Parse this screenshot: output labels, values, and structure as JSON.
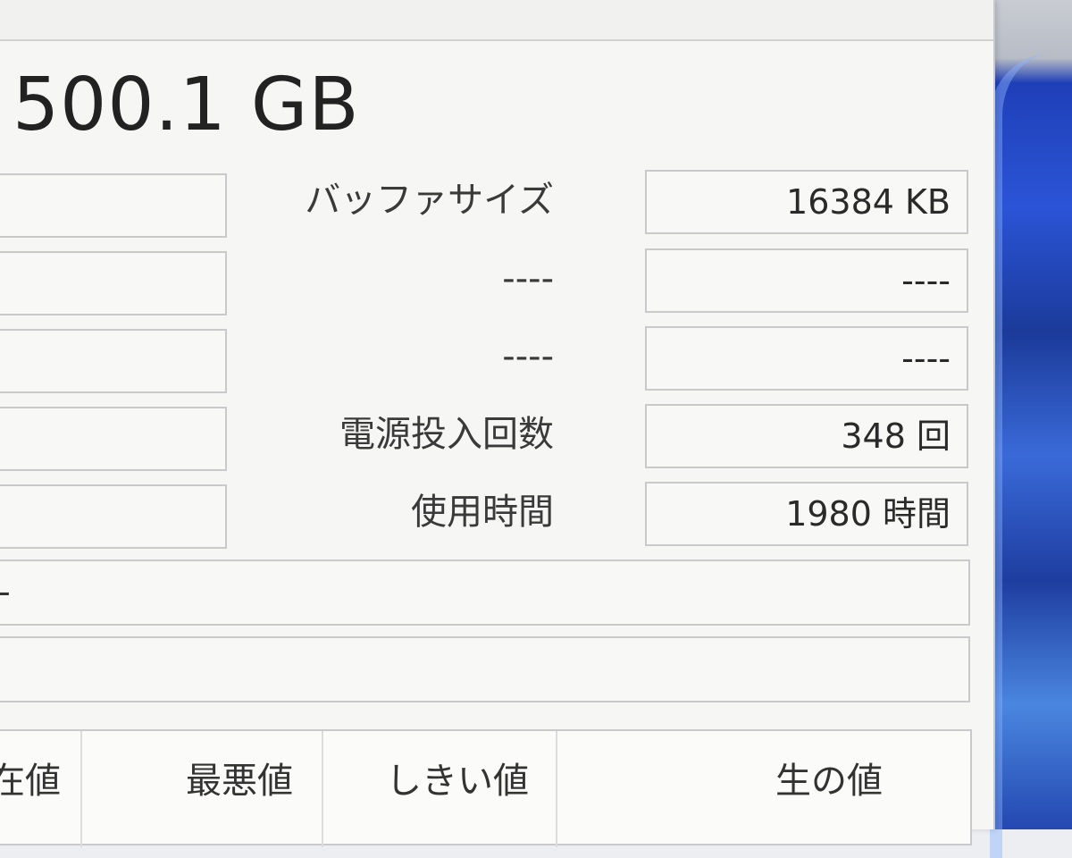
{
  "disk": {
    "capacity": "500.1 GB"
  },
  "info_rows": [
    {
      "label": "バッファサイズ",
      "value": "16384 KB"
    },
    {
      "label": "----",
      "value": "----"
    },
    {
      "label": "----",
      "value": "----"
    },
    {
      "label": "電源投入回数",
      "value": "348 回"
    },
    {
      "label": "使用時間",
      "value": "1980 時間"
    }
  ],
  "wide_fields": [
    {
      "value": "-"
    },
    {
      "value": ""
    }
  ],
  "smart_table": {
    "columns": [
      "在値",
      "最悪値",
      "しきい値",
      "生の値"
    ]
  }
}
